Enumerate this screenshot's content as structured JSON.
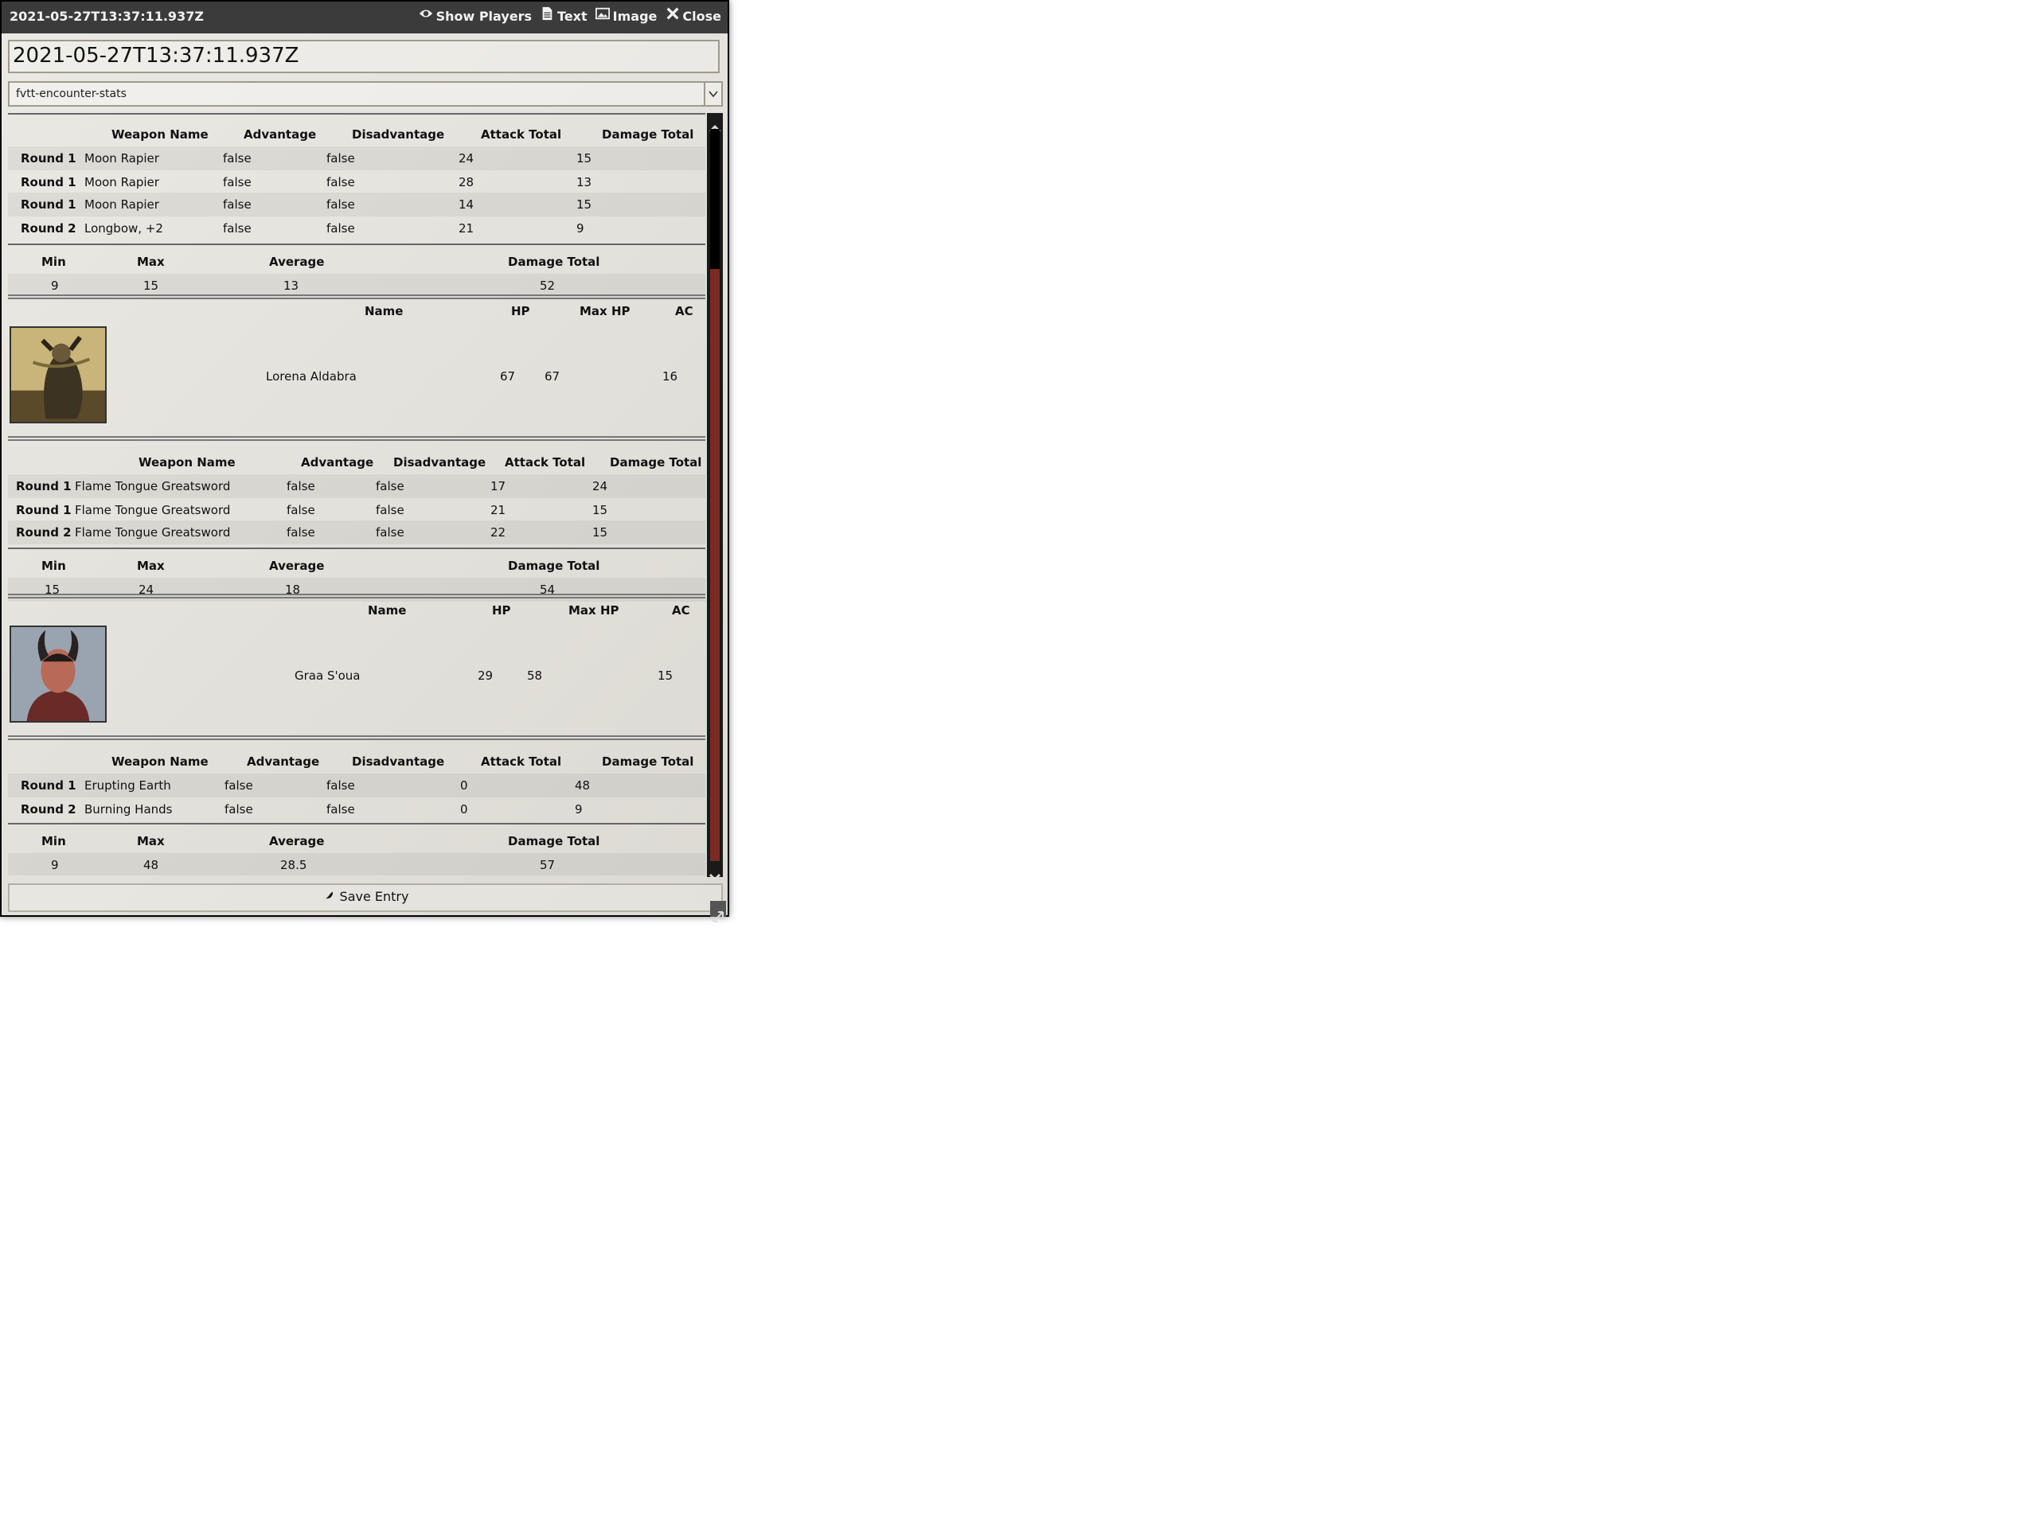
{
  "window": {
    "title": "2021-05-27T13:37:11.937Z",
    "controls": {
      "show_players": "Show Players",
      "text": "Text",
      "image": "Image",
      "close": "Close"
    }
  },
  "entry_name": "2021-05-27T13:37:11.937Z",
  "content_type": "fvtt-encounter-stats",
  "attack_headers": [
    "Weapon Name",
    "Advantage",
    "Disadvantage",
    "Attack Total",
    "Damage Total"
  ],
  "summary_headers": [
    "Min",
    "Max",
    "Average",
    "Damage Total"
  ],
  "combatant_headers": [
    "Name",
    "HP",
    "Max HP",
    "AC"
  ],
  "sections": [
    {
      "attacks": [
        [
          "Round 1",
          "Moon Rapier",
          "false",
          "false",
          "24",
          "15"
        ],
        [
          "Round 1",
          "Moon Rapier",
          "false",
          "false",
          "28",
          "13"
        ],
        [
          "Round 1",
          "Moon Rapier",
          "false",
          "false",
          "14",
          "15"
        ],
        [
          "Round 2",
          "Longbow, +2",
          "false",
          "false",
          "21",
          "9"
        ]
      ],
      "summary": [
        "9",
        "15",
        "13",
        "52"
      ]
    },
    {
      "combatant": {
        "name": "Lorena Aldabra",
        "hp": "67",
        "max_hp": "67",
        "ac": "16",
        "portrait": "armored-warrior-portrait"
      },
      "attacks": [
        [
          "Round 1",
          "Flame Tongue Greatsword",
          "false",
          "false",
          "17",
          "24"
        ],
        [
          "Round 1",
          "Flame Tongue Greatsword",
          "false",
          "false",
          "21",
          "15"
        ],
        [
          "Round 2",
          "Flame Tongue Greatsword",
          "false",
          "false",
          "22",
          "15"
        ]
      ],
      "summary": [
        "15",
        "24",
        "18",
        "54"
      ]
    },
    {
      "combatant": {
        "name": "Graa S'oua",
        "hp": "29",
        "max_hp": "58",
        "ac": "15",
        "portrait": "horned-tiefling-portrait"
      },
      "attacks": [
        [
          "Round 1",
          "Erupting Earth",
          "false",
          "false",
          "0",
          "48"
        ],
        [
          "Round 2",
          "Burning Hands",
          "false",
          "false",
          "0",
          "9"
        ]
      ],
      "summary": [
        "9",
        "48",
        "28.5",
        "57"
      ]
    }
  ],
  "footer": {
    "save_label": "Save Entry"
  },
  "colors": {
    "titlebar": "#3b3b3b",
    "scroll_thumb": "#7b2a22",
    "parchment": "#e3e1da"
  }
}
